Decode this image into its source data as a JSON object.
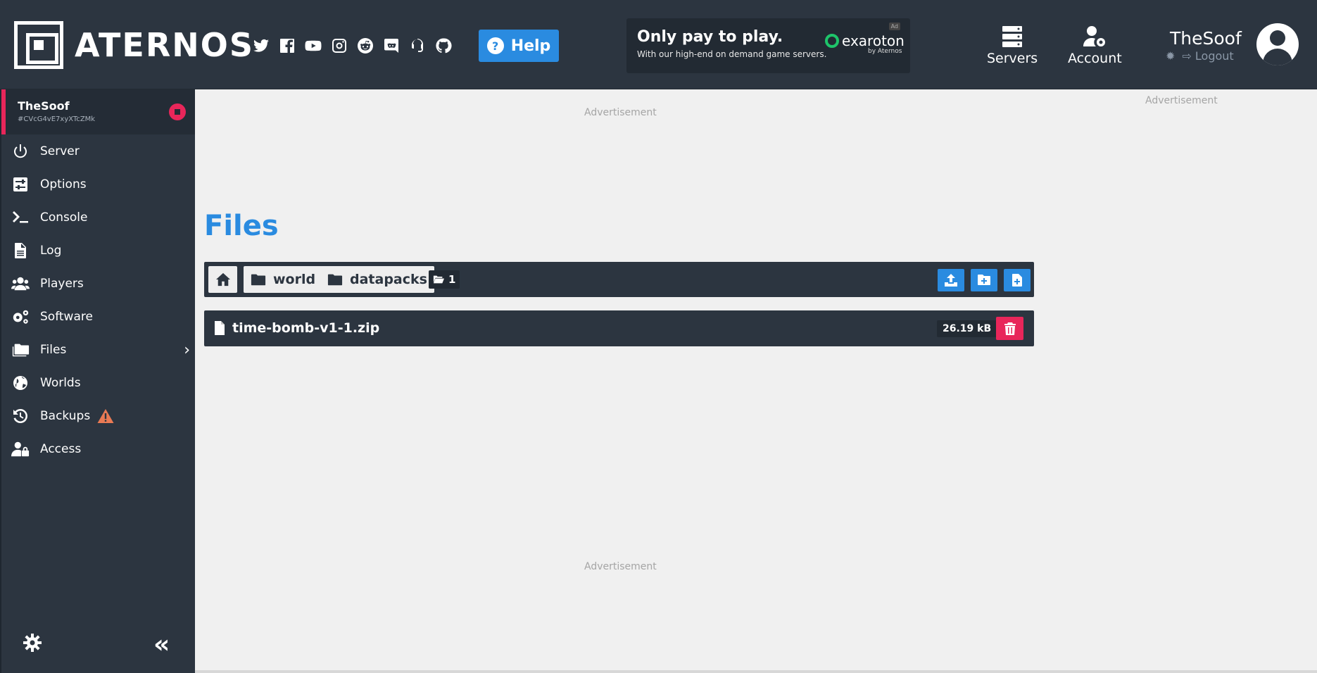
{
  "header": {
    "logo_text": "ATERNOS",
    "socials": [
      "twitter-icon",
      "facebook-icon",
      "youtube-icon",
      "instagram-icon",
      "reddit-icon",
      "discord-icon",
      "support-headset-icon",
      "github-icon"
    ],
    "help_label": "Help",
    "ad": {
      "headline": "Only pay to play.",
      "subline": "With our high-end on demand game servers.",
      "brand": "exaroton",
      "brand_by": "by Aternos",
      "badge": "Ad"
    },
    "nav": {
      "servers_label": "Servers",
      "account_label": "Account"
    },
    "user": {
      "name": "TheSoof",
      "logout_label": "Logout"
    }
  },
  "sidebar": {
    "server_name": "TheSoof",
    "server_id": "#CVcG4vE7xyXTcZMk",
    "items": [
      {
        "label": "Server",
        "icon": "power-icon"
      },
      {
        "label": "Options",
        "icon": "sliders-icon"
      },
      {
        "label": "Console",
        "icon": "terminal-icon"
      },
      {
        "label": "Log",
        "icon": "document-icon"
      },
      {
        "label": "Players",
        "icon": "users-icon"
      },
      {
        "label": "Software",
        "icon": "gears-icon"
      },
      {
        "label": "Files",
        "icon": "folders-icon"
      },
      {
        "label": "Worlds",
        "icon": "globe-icon"
      },
      {
        "label": "Backups",
        "icon": "history-icon"
      },
      {
        "label": "Access",
        "icon": "user-lock-icon"
      }
    ],
    "backups_warning": "warning-icon"
  },
  "main": {
    "ad_label": "Advertisement",
    "title": "Files",
    "breadcrumb": {
      "home": "home-icon",
      "folders": [
        "world",
        "datapacks"
      ],
      "folder_count": "1"
    },
    "actions": [
      "upload-icon",
      "new-folder-icon",
      "new-file-icon"
    ],
    "files": [
      {
        "name": "time-bomb-v1-1.zip",
        "size": "26.19 kB"
      }
    ]
  },
  "colors": {
    "dark": "#2c3540",
    "accent": "#2a8be0",
    "danger": "#e8265a",
    "background": "#f0f0f0"
  }
}
